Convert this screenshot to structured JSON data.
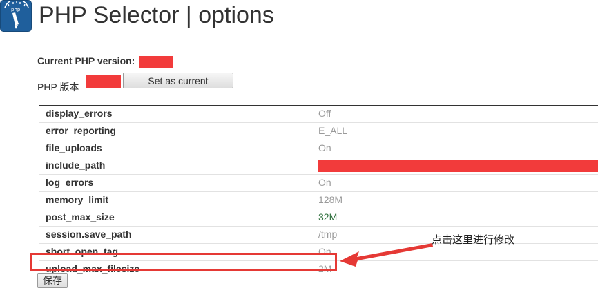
{
  "header": {
    "title": "PHP Selector | options",
    "icon": "php-selector-icon"
  },
  "version": {
    "current_label": "Current PHP version:",
    "version_label": "PHP 版本",
    "set_current_label": "Set as current"
  },
  "options": [
    {
      "name": "display_errors",
      "value": "Off"
    },
    {
      "name": "error_reporting",
      "value": "E_ALL"
    },
    {
      "name": "file_uploads",
      "value": "On"
    },
    {
      "name": "include_path",
      "value": ""
    },
    {
      "name": "log_errors",
      "value": "On"
    },
    {
      "name": "memory_limit",
      "value": "128M"
    },
    {
      "name": "post_max_size",
      "value": "32M"
    },
    {
      "name": "session.save_path",
      "value": "/tmp"
    },
    {
      "name": "short_open_tag",
      "value": "On"
    },
    {
      "name": "upload_max_filesize",
      "value": "2M"
    }
  ],
  "save_label": "保存",
  "annotation": {
    "text": "点击这里进行修改",
    "color": "#e53935"
  },
  "colors": {
    "redaction": "#f23b3b",
    "icon_bg": "#1f5f9c",
    "changed_value": "#2e6f3c"
  }
}
